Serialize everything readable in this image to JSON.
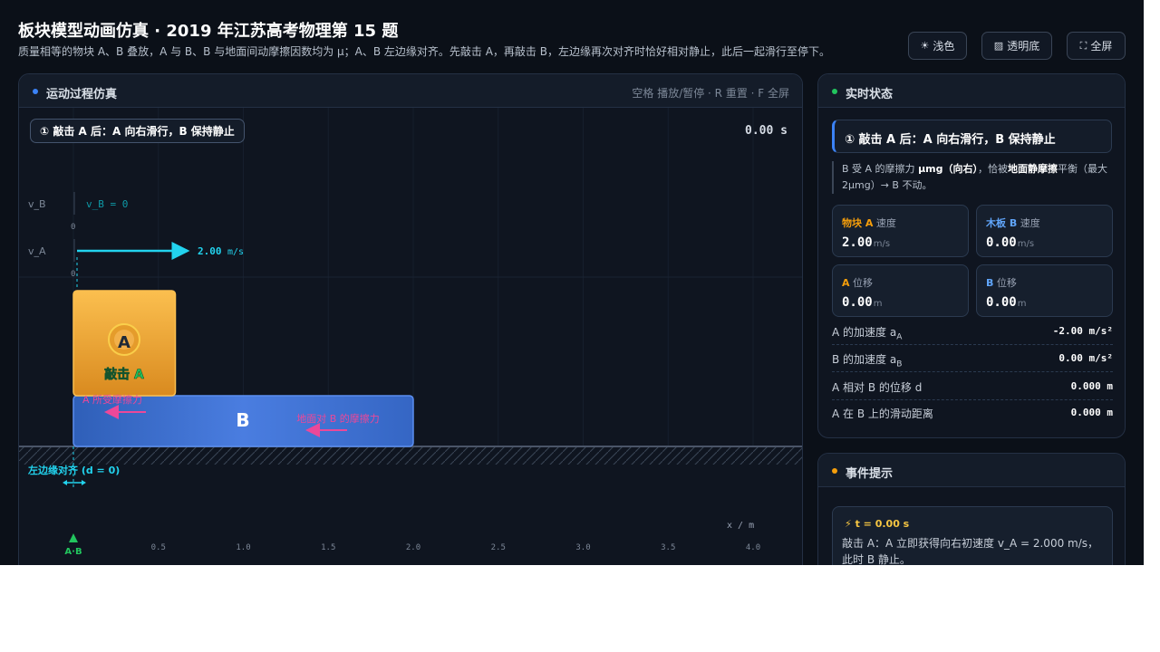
{
  "header": {
    "title": "板块模型动画仿真 · 2019 年江苏高考物理第 15 题",
    "subtitle": "质量相等的物块 A、B 叠放，A 与 B、B 与地面间动摩擦因数均为 μ；A、B 左边缘对齐。先敲击 A，再敲击 B，左边缘再次对齐时恰好相对静止，此后一起滑行至停下。",
    "buttons": [
      {
        "label": "浅色",
        "icon": "sun-icon"
      },
      {
        "label": "透明底",
        "icon": "grid-icon"
      },
      {
        "label": "全屏",
        "icon": "fullscreen-icon"
      }
    ]
  },
  "sim": {
    "title": "运动过程仿真",
    "hint": "空格 播放/暂停 · R 重置 · F 全屏",
    "stage_badge": "① 敲击 A 后：A 向右滑行，B 保持静止",
    "time": "0.00 s",
    "vb_label": "v_B",
    "vb_text": "v_B = 0",
    "va_label": "v_A",
    "va_text": "2.00",
    "va_unit": "m/s",
    "zero": "0",
    "block_a_letter": "A",
    "block_a_caption": "敲击 A",
    "block_a_friction_label": "A 所受摩擦力",
    "block_b_letter": "B",
    "ground_friction_label": "地面对 B 的摩擦力",
    "align_label": "左边缘对齐 (d = 0)",
    "axis_label": "x / m",
    "ab_marker": "A·B",
    "ticks": [
      "0.5",
      "1.0",
      "1.5",
      "2.0",
      "2.5",
      "3.0",
      "3.5",
      "4.0"
    ]
  },
  "chart_data": {
    "type": "scatter",
    "title": "",
    "xlabel": "x / m",
    "ylabel": "",
    "x_ticks": [
      0.5,
      1.0,
      1.5,
      2.0,
      2.5,
      3.0,
      3.5,
      4.0
    ],
    "xlim": [
      0,
      4.0
    ],
    "block_a": {
      "x_left": 0,
      "length": 0.6,
      "velocity": 2.0
    },
    "block_b": {
      "x_left": 0,
      "length": 2.0,
      "velocity": 0.0
    }
  },
  "status": {
    "title": "实时状态",
    "state_title": "① 敲击 A 后：A 向右滑行，B 保持静止",
    "desc_1": "B 受 A 的摩擦力 ",
    "desc_2": "μmg（向右）",
    "desc_3": "，恰被",
    "desc_4": "地面静摩擦",
    "desc_5": "平衡（最大 2μmg）→ B 不动。",
    "metrics": [
      {
        "who": "物块 A",
        "what": " 速度",
        "value": "2.00",
        "unit": "m/s",
        "color": "#f59e0b"
      },
      {
        "who": "木板 B",
        "what": " 速度",
        "value": "0.00",
        "unit": "m/s",
        "color": "#60a5fa"
      },
      {
        "who": "A",
        "what": " 位移",
        "value": "0.00",
        "unit": "m",
        "color": "#f59e0b"
      },
      {
        "who": "B",
        "what": " 位移",
        "value": "0.00",
        "unit": "m",
        "color": "#60a5fa"
      }
    ],
    "rows": [
      {
        "k": "A 的加速度 a",
        "sub": "A",
        "v": "-2.00 m/s²"
      },
      {
        "k": "B 的加速度 a",
        "sub": "B",
        "v": "0.00 m/s²"
      },
      {
        "k": "A 相对 B 的位移 d",
        "sub": "",
        "v": "0.000 m"
      },
      {
        "k": "A 在 B 上的滑动距离",
        "sub": "",
        "v": "0.000 m"
      }
    ]
  },
  "events": {
    "title": "事件提示",
    "time_label": "t = 0.00 s",
    "body": "敲击 A：A 立即获得向右初速度 v_A = 2.000 m/s，此时 B 静止。"
  },
  "colors": {
    "accent_blue": "#3b82f6",
    "accent_green": "#22c55e",
    "accent_orange": "#f59e0b",
    "velocity_cyan": "#22d3ee",
    "friction_pink": "#ec4899"
  }
}
